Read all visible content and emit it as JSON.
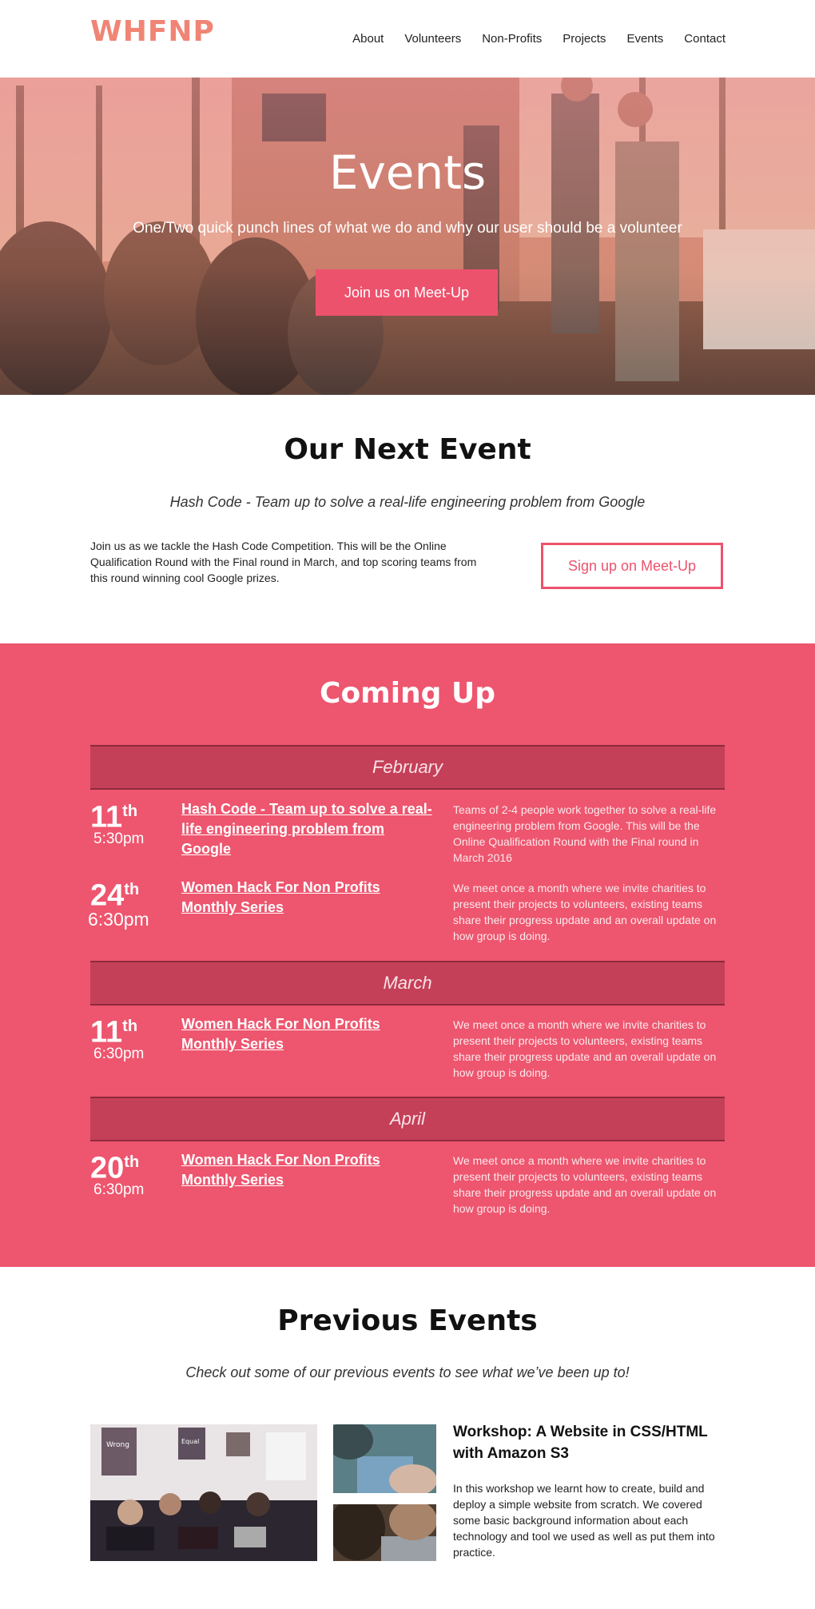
{
  "header": {
    "logo": "WHFNP",
    "nav": [
      "About",
      "Volunteers",
      "Non-Profits",
      "Projects",
      "Events",
      "Contact"
    ]
  },
  "hero": {
    "title": "Events",
    "subtitle": "One/Two quick punch lines of what we do and why our user should be a volunteer",
    "button": "Join us on Meet-Up"
  },
  "next_event": {
    "title": "Our Next Event",
    "subtitle": "Hash Code - Team up to solve a real-life engineering problem from Google",
    "description": "Join us as we tackle the Hash Code Competition. This will be the Online Qualification Round with the Final round in March, and top scoring teams from this round winning cool Google prizes.",
    "button": "Sign up on Meet-Up"
  },
  "coming_up": {
    "title": "Coming Up",
    "months": [
      "February",
      "March",
      "April"
    ],
    "events": [
      {
        "day": "11",
        "suffix": "th",
        "time": "5:30pm",
        "title": "Hash Code - Team up to solve a real-life engineering problem from Google",
        "desc": "Teams of 2-4 people work together to solve a real-life engineering problem from Google. This will be the Online Qualification Round with the Final round in March 2016"
      },
      {
        "day": "24",
        "suffix": "th",
        "time": "6:30pm",
        "title": "Women Hack For Non Profits Monthly Series",
        "desc": "We meet once a month where we invite charities to present their projects to volunteers, existing teams share their progress update and an overall update on how group is doing."
      },
      {
        "day": "11",
        "suffix": "th",
        "time": "6:30pm",
        "title": "Women Hack For Non Profits Monthly Series",
        "desc": "We meet once a month where we invite charities to present their projects to volunteers, existing teams share their progress update and an overall update on how group is doing."
      },
      {
        "day": "20",
        "suffix": "th",
        "time": "6:30pm",
        "title": "Women Hack For Non Profits Monthly Series",
        "desc": "We meet once a month where we invite charities to present their projects to volunteers, existing teams share their progress update and an overall update on how group is doing."
      }
    ]
  },
  "previous": {
    "title": "Previous Events",
    "subtitle": "Check out some of our previous events to see what we’ve been up to!",
    "workshop_title": "Workshop: A Website in CSS/HTML with Amazon S3",
    "workshop_desc": "In this workshop we learnt how to create, build and deploy a simple website from scratch. We covered some basic background information about each technology and tool we  used as well as put them into practice.",
    "poster_left": "Wrong",
    "poster_mid": "Equal"
  },
  "colors": {
    "accent": "#ee556e",
    "month_bar": "#c44058",
    "logo": "#f08575"
  }
}
